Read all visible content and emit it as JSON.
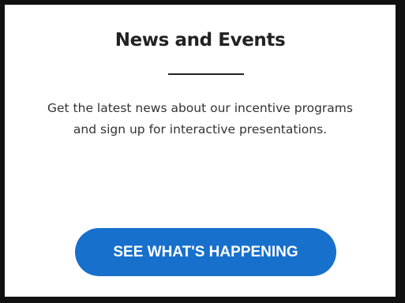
{
  "card": {
    "title": "News and Events",
    "description": "Get the latest news about our incentive programs and sign up for interactive presentations.",
    "cta_label": "SEE WHAT'S HAPPENING"
  },
  "colors": {
    "border": "#111111",
    "title": "#222222",
    "text": "#333333",
    "button_bg": "#1770cc",
    "button_text": "#ffffff"
  }
}
